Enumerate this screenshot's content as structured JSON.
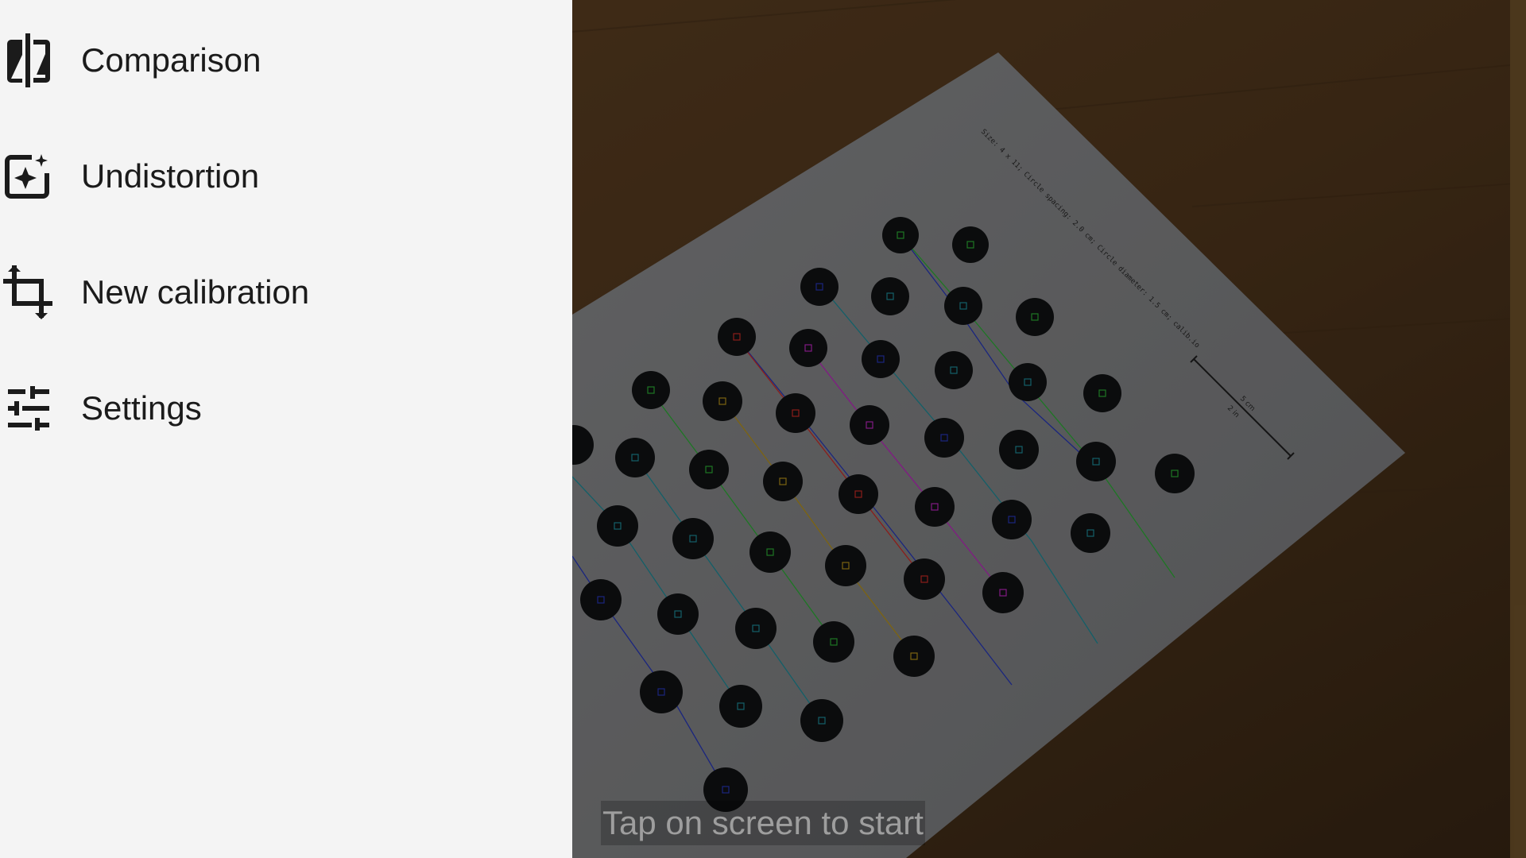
{
  "drawer": {
    "items": [
      {
        "label": "Comparison",
        "icon": "compare-icon"
      },
      {
        "label": "Undistortion",
        "icon": "auto-fix-image-icon"
      },
      {
        "label": "New calibration",
        "icon": "crop-icon"
      },
      {
        "label": "Settings",
        "icon": "tune-sliders-icon"
      }
    ]
  },
  "camera": {
    "hint": "Tap on screen to start",
    "pattern_sheet_caption": "Size: 4 x 11; Circle spacing: 2.0 cm; Circle diameter: 1.5 cm; calib.io",
    "scale_labels": [
      "5 cm",
      "2 in"
    ]
  },
  "colors": {
    "drawer_background": "#f4f4f4",
    "label_text": "#1b1b1b",
    "wood": "#5a3e22",
    "paper": "#8e8f92",
    "hint_text": "#9e9e9e"
  }
}
